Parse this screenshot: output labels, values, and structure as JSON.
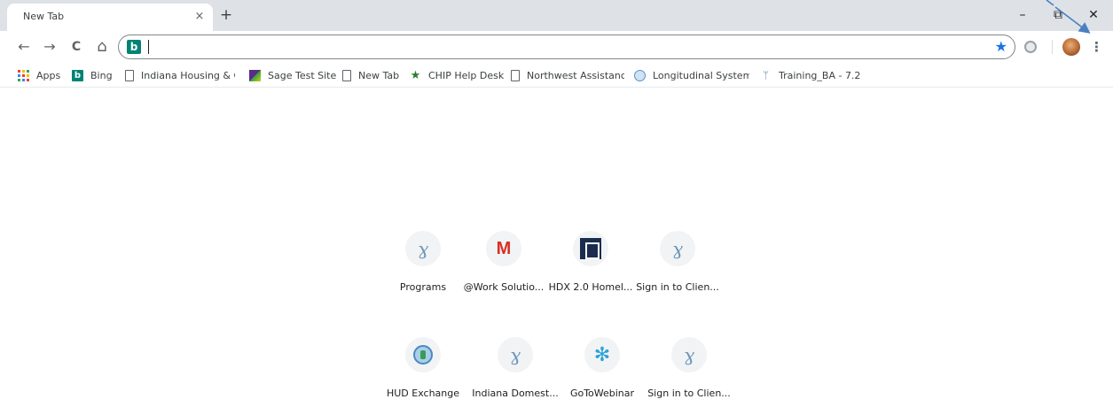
{
  "tab": {
    "title": "New Tab",
    "close_glyph": "×",
    "new_tab_glyph": "+"
  },
  "window": {
    "minimize_glyph": "–",
    "restore_glyph": "⧉",
    "close_glyph": "✕"
  },
  "toolbar": {
    "back_glyph": "←",
    "forward_glyph": "→",
    "reload_glyph": "C",
    "home_glyph": "⌂",
    "omnibox_value": "",
    "search_engine_logo": "b",
    "bookmark_star_glyph": "★",
    "menu_glyph": "⋮"
  },
  "bookmarks": [
    {
      "label": "Apps",
      "icon": "apps-grid-icon"
    },
    {
      "label": "Bing",
      "icon": "bing-icon"
    },
    {
      "label": "Indiana Housing & C",
      "icon": "page-icon"
    },
    {
      "label": "Sage Test Site",
      "icon": "sage-icon"
    },
    {
      "label": "New Tab",
      "icon": "page-icon"
    },
    {
      "label": "CHIP Help Desk",
      "icon": "star-icon"
    },
    {
      "label": "Northwest Assistance",
      "icon": "page-icon"
    },
    {
      "label": "Longitudinal System",
      "icon": "longitudinal-icon"
    },
    {
      "label": "Training_BA - 7.2",
      "icon": "training-icon"
    }
  ],
  "shortcuts": [
    {
      "label": "Programs",
      "icon": "figure-icon"
    },
    {
      "label": "@Work Solutio...",
      "icon": "gmail-icon"
    },
    {
      "label": "HDX 2.0 Homel...",
      "icon": "hdx-icon"
    },
    {
      "label": "Sign in to Clien...",
      "icon": "figure-icon"
    },
    {
      "label": "HUD Exchange",
      "icon": "hud-icon"
    },
    {
      "label": "Indiana Domest...",
      "icon": "figure-icon"
    },
    {
      "label": "GoToWebinar",
      "icon": "gotowebinar-icon"
    },
    {
      "label": "Sign in to Clien...",
      "icon": "figure-icon"
    }
  ],
  "colors": {
    "tabstrip_bg": "#dee1e6",
    "accent_blue": "#1a73e8",
    "bing_teal": "#008373",
    "annotation_arrow": "#4a7fc1"
  },
  "glyphs": {
    "figure": "ɣ",
    "gmail": "M",
    "gotowebinar": "✻",
    "chip_star": "★",
    "training": "ᛘ"
  }
}
